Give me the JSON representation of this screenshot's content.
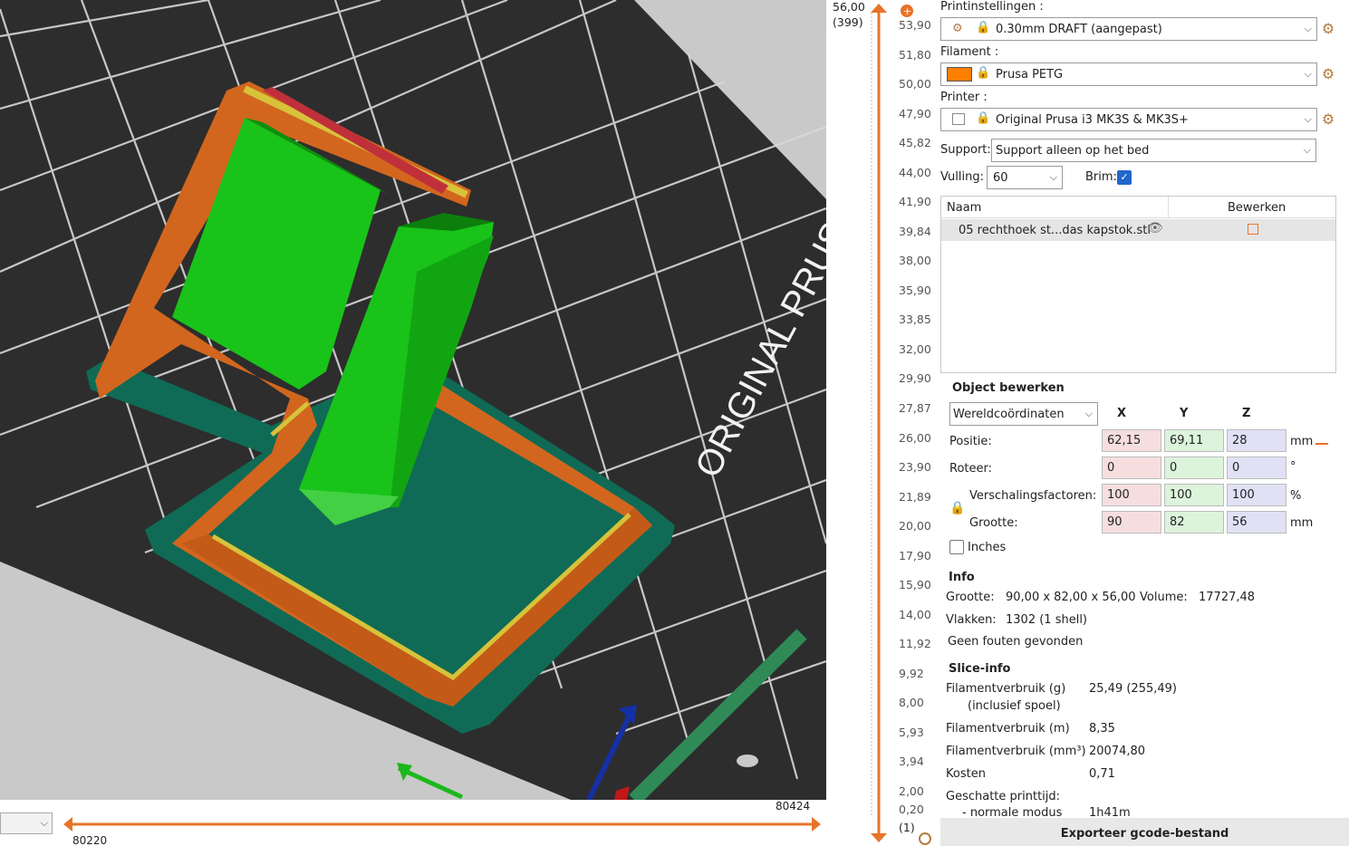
{
  "viewport": {
    "bed_text": "ORIGINAL PRUSA"
  },
  "hslider": {
    "label_right": "80424",
    "label_left": "80220"
  },
  "vslider": {
    "top_value": "56,00",
    "top_layer": "(399)",
    "bottom_value": "0,20",
    "bottom_layer": "(1)",
    "ticks": [
      "53,90",
      "51,80",
      "50,00",
      "47,90",
      "45,82",
      "44,00",
      "41,90",
      "39,84",
      "38,00",
      "35,90",
      "33,85",
      "32,00",
      "29,90",
      "27,87",
      "26,00",
      "23,90",
      "21,89",
      "20,00",
      "17,90",
      "15,90",
      "14,00",
      "11,92",
      "9,92",
      "8,00",
      "5,93",
      "3,94",
      "2,00"
    ]
  },
  "panel": {
    "print_settings_label": "Printinstellingen :",
    "print_settings_value": "0.30mm DRAFT (aangepast)",
    "filament_label": "Filament :",
    "filament_value": "Prusa PETG",
    "filament_color": "#ff8000",
    "printer_label": "Printer :",
    "printer_value": "Original Prusa i3 MK3S & MK3S+",
    "support_label": "Support:",
    "support_value": "Support alleen op het bed",
    "infill_label": "Vulling:",
    "infill_value": "60",
    "brim_label": "Brim:",
    "brim_checked": true,
    "list_header_name": "Naam",
    "list_header_edit": "Bewerken",
    "object_name": "05 rechthoek st...das kapstok.stl",
    "object_edit_title": "Object bewerken",
    "coord_system": "Wereldcoördinaten",
    "col_x": "X",
    "col_y": "Y",
    "col_z": "Z",
    "pos_label": "Positie:",
    "pos": [
      "62,15",
      "69,11",
      "28"
    ],
    "pos_unit": "mm",
    "rot_label": "Roteer:",
    "rot": [
      "0",
      "0",
      "0"
    ],
    "rot_unit": "°",
    "scale_label": "Verschalingsfactoren:",
    "scale": [
      "100",
      "100",
      "100"
    ],
    "scale_unit": "%",
    "size_label": "Grootte:",
    "size": [
      "90",
      "82",
      "56"
    ],
    "size_unit": "mm",
    "inches_label": "Inches",
    "info_title": "Info",
    "info_size_label": "Grootte:",
    "info_size_value": "90,00 x 82,00 x 56,00",
    "info_volume_label": "Volume:",
    "info_volume_value": "17727,48",
    "info_facets_label": "Vlakken:",
    "info_facets_value": "1302 (1 shell)",
    "info_errors": "Geen fouten gevonden",
    "slice_title": "Slice-info",
    "slice_g_label": "Filamentverbruik (g)",
    "slice_g_sub": "(inclusief spoel)",
    "slice_g_value": "25,49 (255,49)",
    "slice_m_label": "Filamentverbruik (m)",
    "slice_m_value": "8,35",
    "slice_mm3_label": "Filamentverbruik (mm³)",
    "slice_mm3_value": "20074,80",
    "slice_cost_label": "Kosten",
    "slice_cost_value": "0,71",
    "slice_time_label": "Geschatte printtijd:",
    "slice_time_mode": "- normale modus",
    "slice_time_value": "1h41m",
    "export_label": "Exporteer gcode-bestand"
  }
}
